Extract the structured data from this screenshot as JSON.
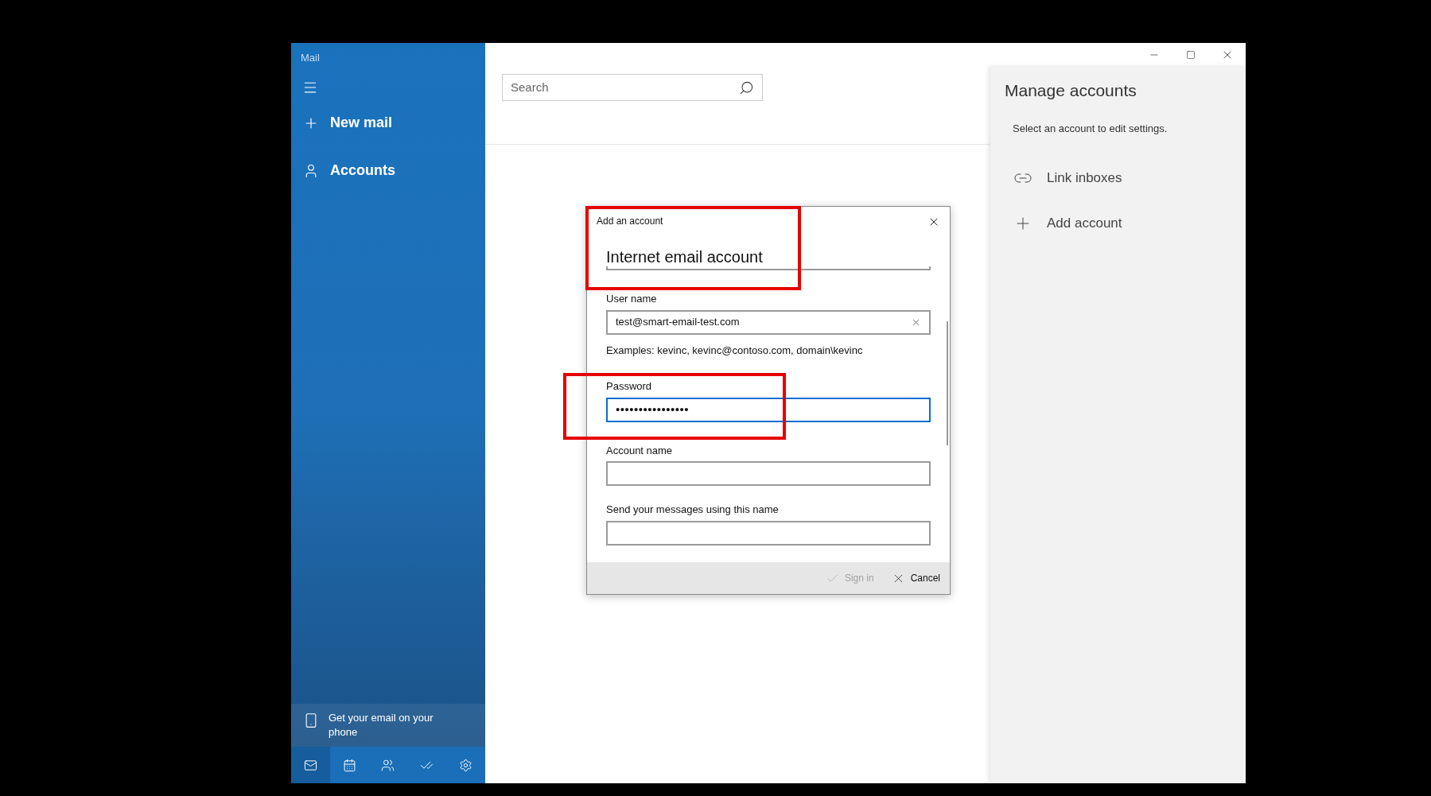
{
  "window": {
    "app_title": "Mail"
  },
  "sidebar": {
    "items": [
      {
        "kind": "new",
        "label": "New mail"
      },
      {
        "kind": "accounts",
        "label": "Accounts"
      }
    ],
    "promo": "Get your email on your phone",
    "bottom_nav": [
      {
        "kind": "mail",
        "selected": true
      },
      {
        "kind": "calendar",
        "selected": false
      },
      {
        "kind": "people",
        "selected": false
      },
      {
        "kind": "todo",
        "selected": false
      },
      {
        "kind": "settings",
        "selected": false
      }
    ]
  },
  "search": {
    "placeholder": "Search"
  },
  "manage_accounts": {
    "title": "Manage accounts",
    "hint": "Select an account to edit settings.",
    "actions": [
      {
        "kind": "link",
        "label": "Link inboxes"
      },
      {
        "kind": "add",
        "label": "Add account"
      }
    ]
  },
  "dialog": {
    "caption": "Add an account",
    "title": "Internet email account",
    "fields": [
      {
        "label": "User name",
        "value": "test@smart-email-test.com",
        "focused": false,
        "clearable": true,
        "helper": "Examples: kevinc, kevinc@contoso.com, domain\\kevinc"
      },
      {
        "label": "Password",
        "value": "••••••••••••••••",
        "focused": true,
        "clearable": false
      },
      {
        "label": "Account name",
        "focused": false,
        "clearable": false
      },
      {
        "label": "Send your messages using this name",
        "focused": false,
        "clearable": false
      }
    ],
    "buttons": [
      {
        "kind": "sign_in",
        "label": "Sign in",
        "disabled": true
      },
      {
        "kind": "cancel",
        "label": "Cancel",
        "disabled": false
      }
    ]
  },
  "annotations": [
    {
      "kind": "highlight"
    },
    {
      "kind": "highlight"
    }
  ]
}
